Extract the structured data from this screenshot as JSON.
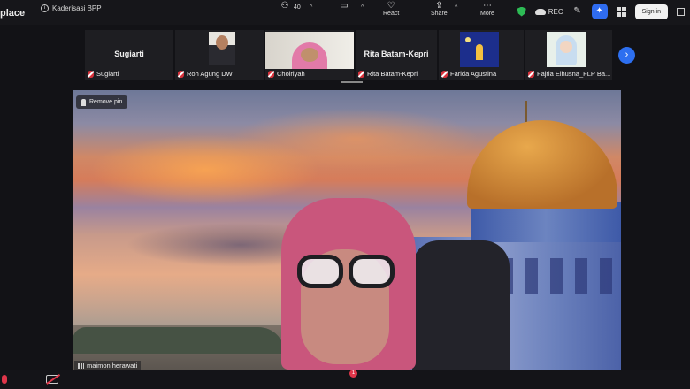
{
  "app": {
    "name": "place",
    "meeting_title": "Kaderisasi BPP"
  },
  "top_right": {
    "rec_label": "REC",
    "sign_in_label": "Sign in"
  },
  "participants": [
    {
      "name": "Sugiarti",
      "label": "Sugiarti",
      "video": false
    },
    {
      "name": "Roh Agung DW",
      "label": "Roh Agung DW",
      "video": true
    },
    {
      "name": "Choiriyah",
      "label": "Choiriyah",
      "video": true
    },
    {
      "name": "Rita Batam-Kepri",
      "label": "Rita Batam-Kepri",
      "video": false
    },
    {
      "name": "Farida Agustina",
      "label": "Farida Agustina",
      "video": true
    },
    {
      "name": "Fajria Elhusna_FLP Ba...",
      "label": "Fajria Elhusna_FLP Ba...",
      "video": true
    }
  ],
  "main": {
    "remove_pin_label": "Remove pin",
    "speaker_name": "maimon herawati"
  },
  "toolbar": {
    "participants_count": "40",
    "chat_badge": "1",
    "react_label": "React",
    "share_label": "Share",
    "more_label": "More"
  },
  "colors": {
    "accent": "#2d6ff0",
    "muted_red": "#d8323c",
    "secure_green": "#2dbb55"
  }
}
